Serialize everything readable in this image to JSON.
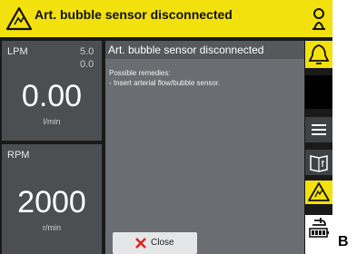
{
  "alarm": {
    "text": "Art. bubble sensor disconnected",
    "color": "#f2e10d",
    "warning_icon": "warning-triangle-icon",
    "speaker_icon": "audio-paused-icon"
  },
  "lpm": {
    "label": "LPM",
    "limit_high": "5.0",
    "limit_low": "0.0",
    "value": "0.00",
    "unit": "l/min"
  },
  "rpm": {
    "label": "RPM",
    "value": "2000",
    "unit": "r/min"
  },
  "popup": {
    "title": "Art. bubble sensor disconnected",
    "remedies_heading": "Possible remedies:",
    "remedy": "- Insert arterial flow/bubble sensor.",
    "close_label": "Close"
  },
  "sidebar": {
    "items": [
      {
        "icon": "bell-icon"
      },
      {
        "icon": "blank"
      },
      {
        "icon": "menu-icon"
      },
      {
        "icon": "manual-icon"
      },
      {
        "icon": "alarm-list-icon"
      },
      {
        "icon": "battery-power-icon"
      }
    ]
  },
  "side_letter": "B"
}
